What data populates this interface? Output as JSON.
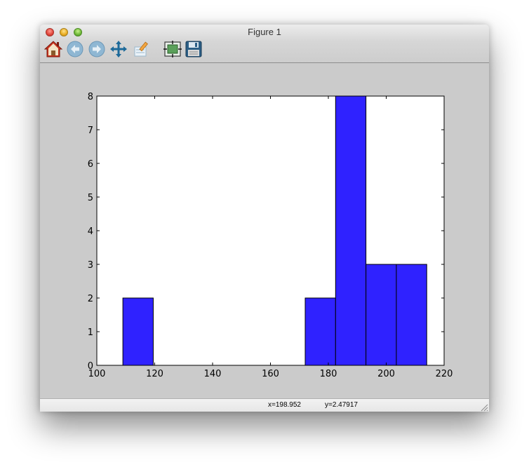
{
  "window": {
    "title": "Figure 1"
  },
  "toolbar": {
    "tools": [
      {
        "icon": "home-icon"
      },
      {
        "icon": "back-arrow-icon"
      },
      {
        "icon": "forward-arrow-icon"
      },
      {
        "icon": "pan-icon"
      },
      {
        "icon": "zoom-to-rect-icon"
      },
      {
        "icon": "subplots-configure-icon"
      },
      {
        "icon": "save-floppy-icon"
      }
    ]
  },
  "status": {
    "x_readout": "x=198.952",
    "y_readout": "y=2.47917"
  },
  "colors": {
    "bar_fill": "#2f22ff",
    "window_bg": "#cbcbcb",
    "axes_bg": "#ffffff"
  },
  "chart_data": {
    "type": "bar",
    "title": "",
    "xlabel": "",
    "ylabel": "",
    "xlim": [
      100,
      220
    ],
    "ylim": [
      0,
      8
    ],
    "xticks": [
      "100",
      "120",
      "140",
      "160",
      "180",
      "200",
      "220"
    ],
    "yticks": [
      "0",
      "1",
      "2",
      "3",
      "4",
      "5",
      "6",
      "7",
      "8"
    ],
    "bin_edges": [
      109,
      119.5,
      130,
      140.5,
      151,
      161.5,
      172,
      182.5,
      193,
      203.5,
      214
    ],
    "values": [
      2,
      0,
      0,
      0,
      0,
      0,
      2,
      8,
      3,
      3
    ],
    "grid": false
  }
}
